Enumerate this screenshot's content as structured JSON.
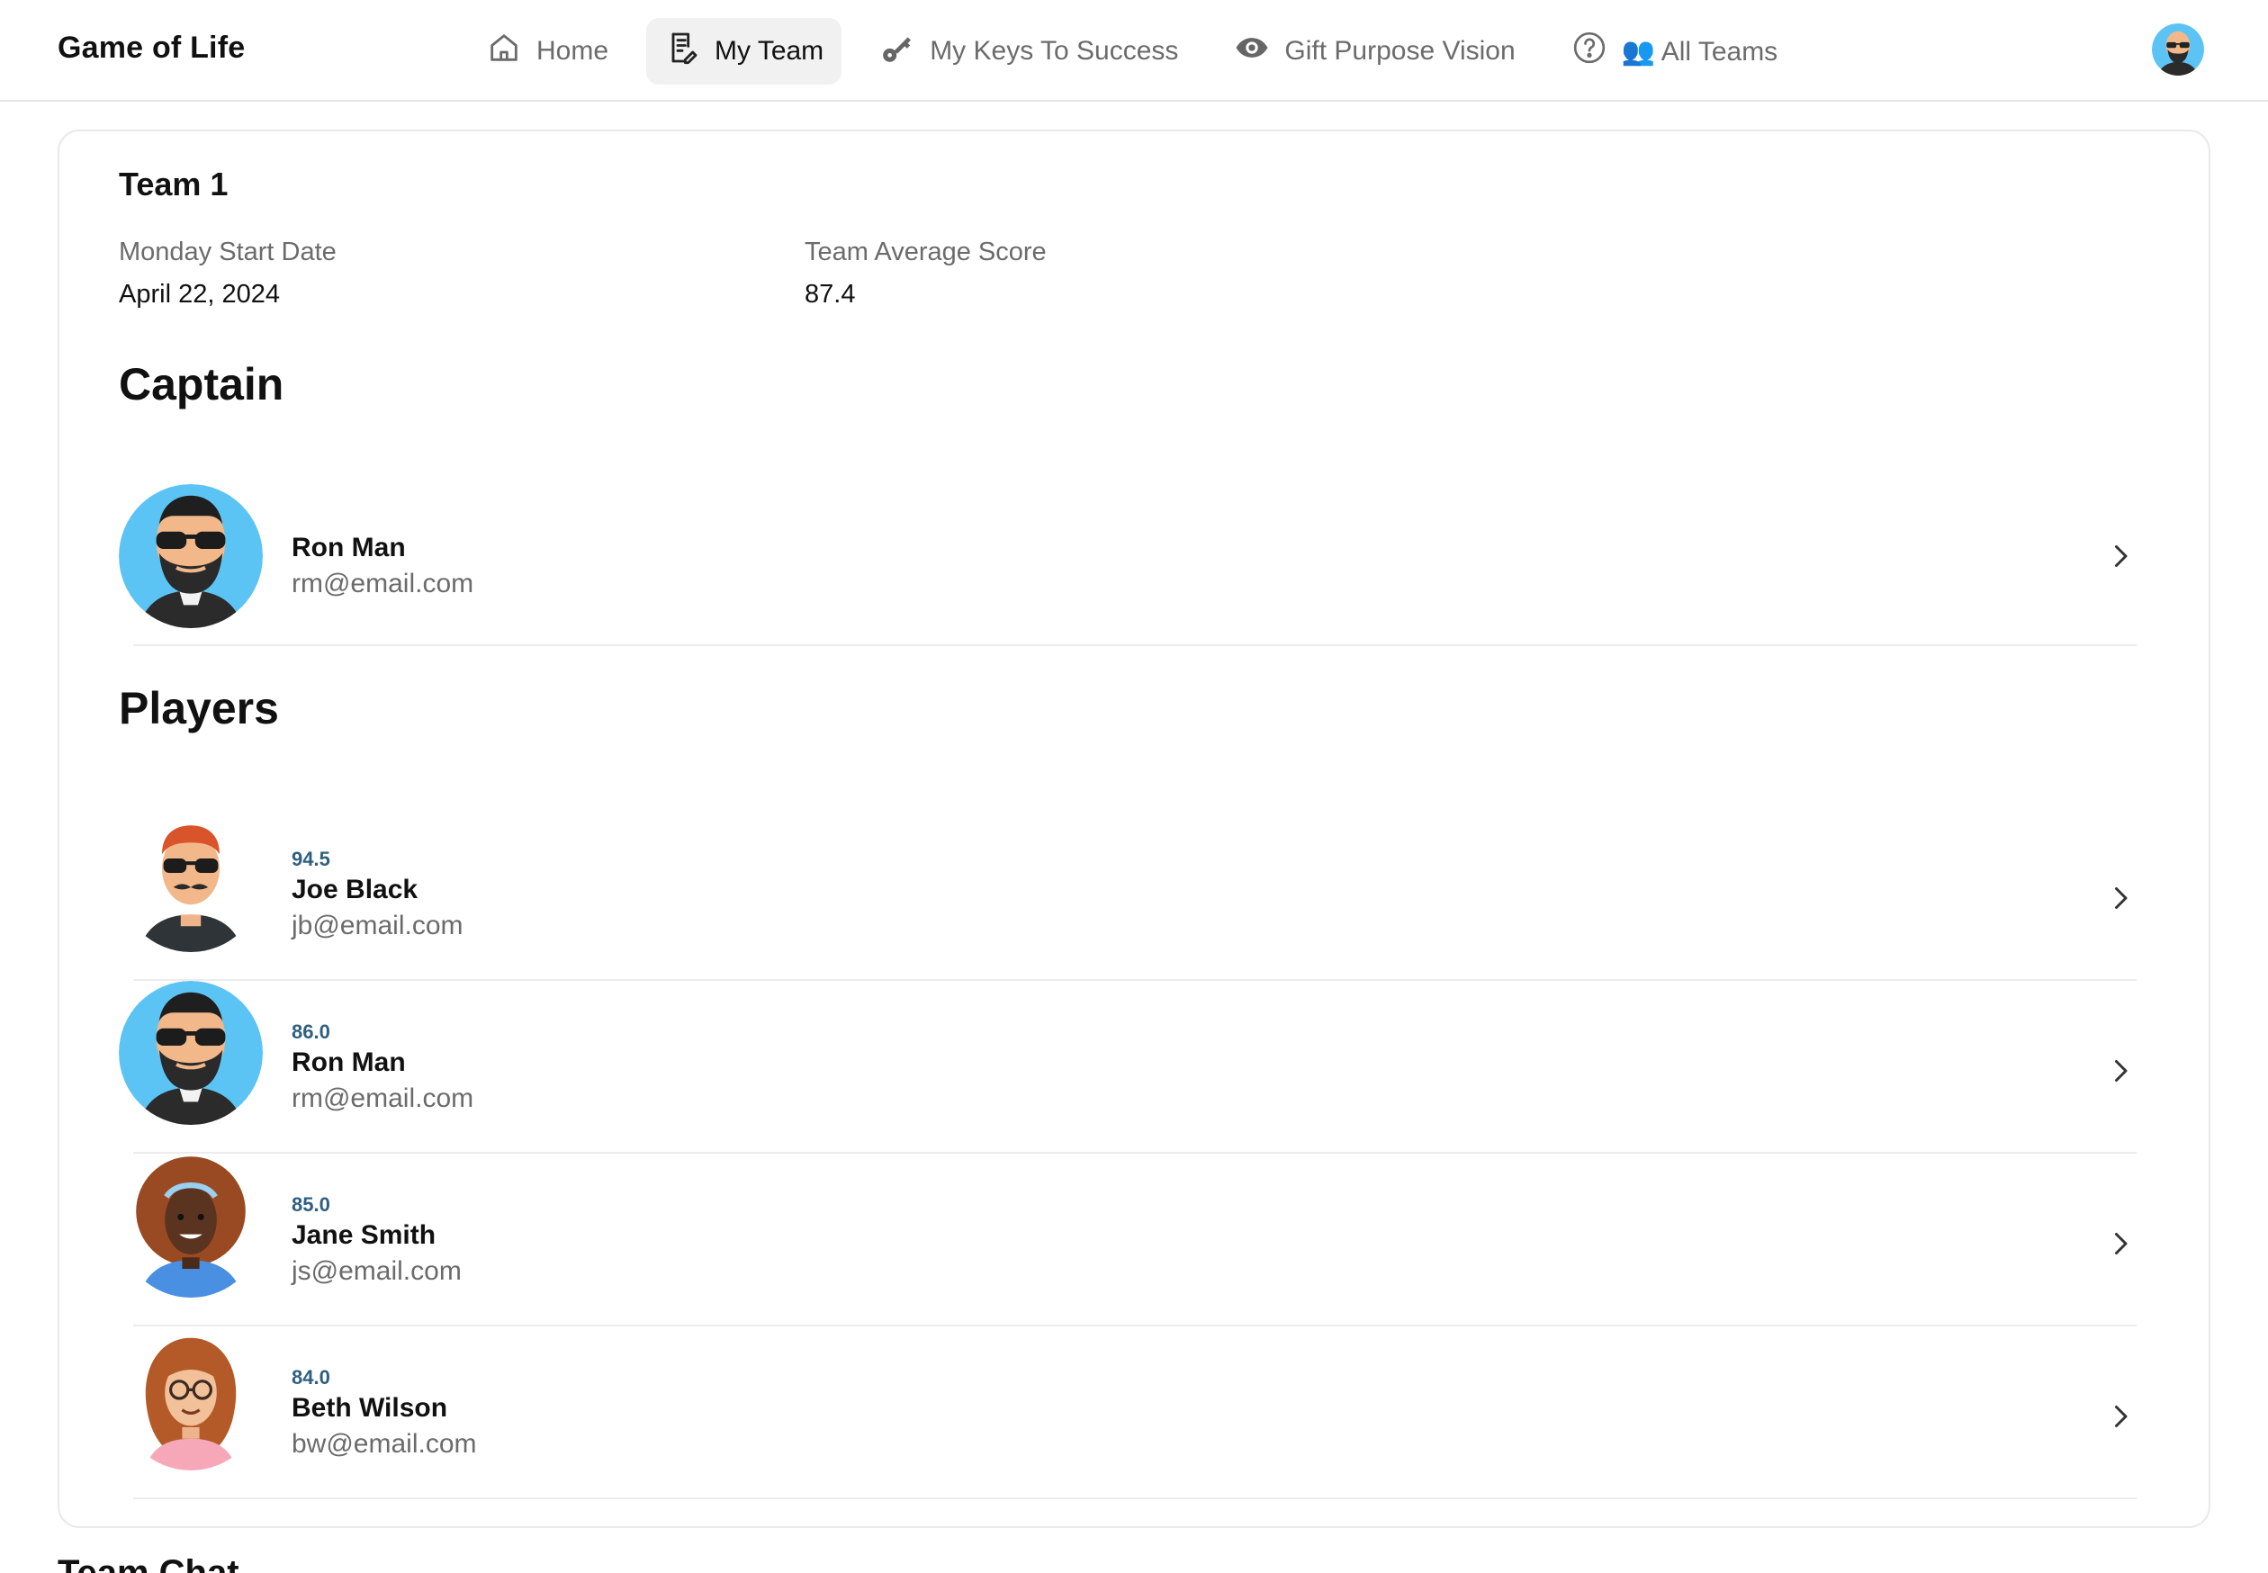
{
  "app": {
    "title": "Game of Life"
  },
  "nav": {
    "items": [
      {
        "label": "Home",
        "icon": "home-icon"
      },
      {
        "label": "My Team",
        "icon": "document-edit-icon",
        "active": true
      },
      {
        "label": "My Keys To Success",
        "icon": "key-icon"
      },
      {
        "label": "Gift Purpose Vision",
        "icon": "eye-icon"
      },
      {
        "label": "👥 All Teams",
        "icon": "question-circle-icon"
      }
    ]
  },
  "team": {
    "name": "Team 1",
    "start_date_label": "Monday Start Date",
    "start_date": "April 22, 2024",
    "avg_score_label": "Team Average Score",
    "avg_score": "87.4"
  },
  "captain": {
    "section_title": "Captain",
    "name": "Ron Man",
    "email": "rm@email.com"
  },
  "players": {
    "section_title": "Players",
    "items": [
      {
        "score": "94.5",
        "name": "Joe Black",
        "email": "jb@email.com"
      },
      {
        "score": "86.0",
        "name": "Ron Man",
        "email": "rm@email.com"
      },
      {
        "score": "85.0",
        "name": "Jane Smith",
        "email": "js@email.com"
      },
      {
        "score": "84.0",
        "name": "Beth Wilson",
        "email": "bw@email.com"
      }
    ]
  },
  "chat": {
    "title": "Team Chat"
  },
  "colors": {
    "score_text": "#2f5f80",
    "active_nav_bg": "#f1f1f1",
    "avatar_blue": "#5cc4f4"
  }
}
